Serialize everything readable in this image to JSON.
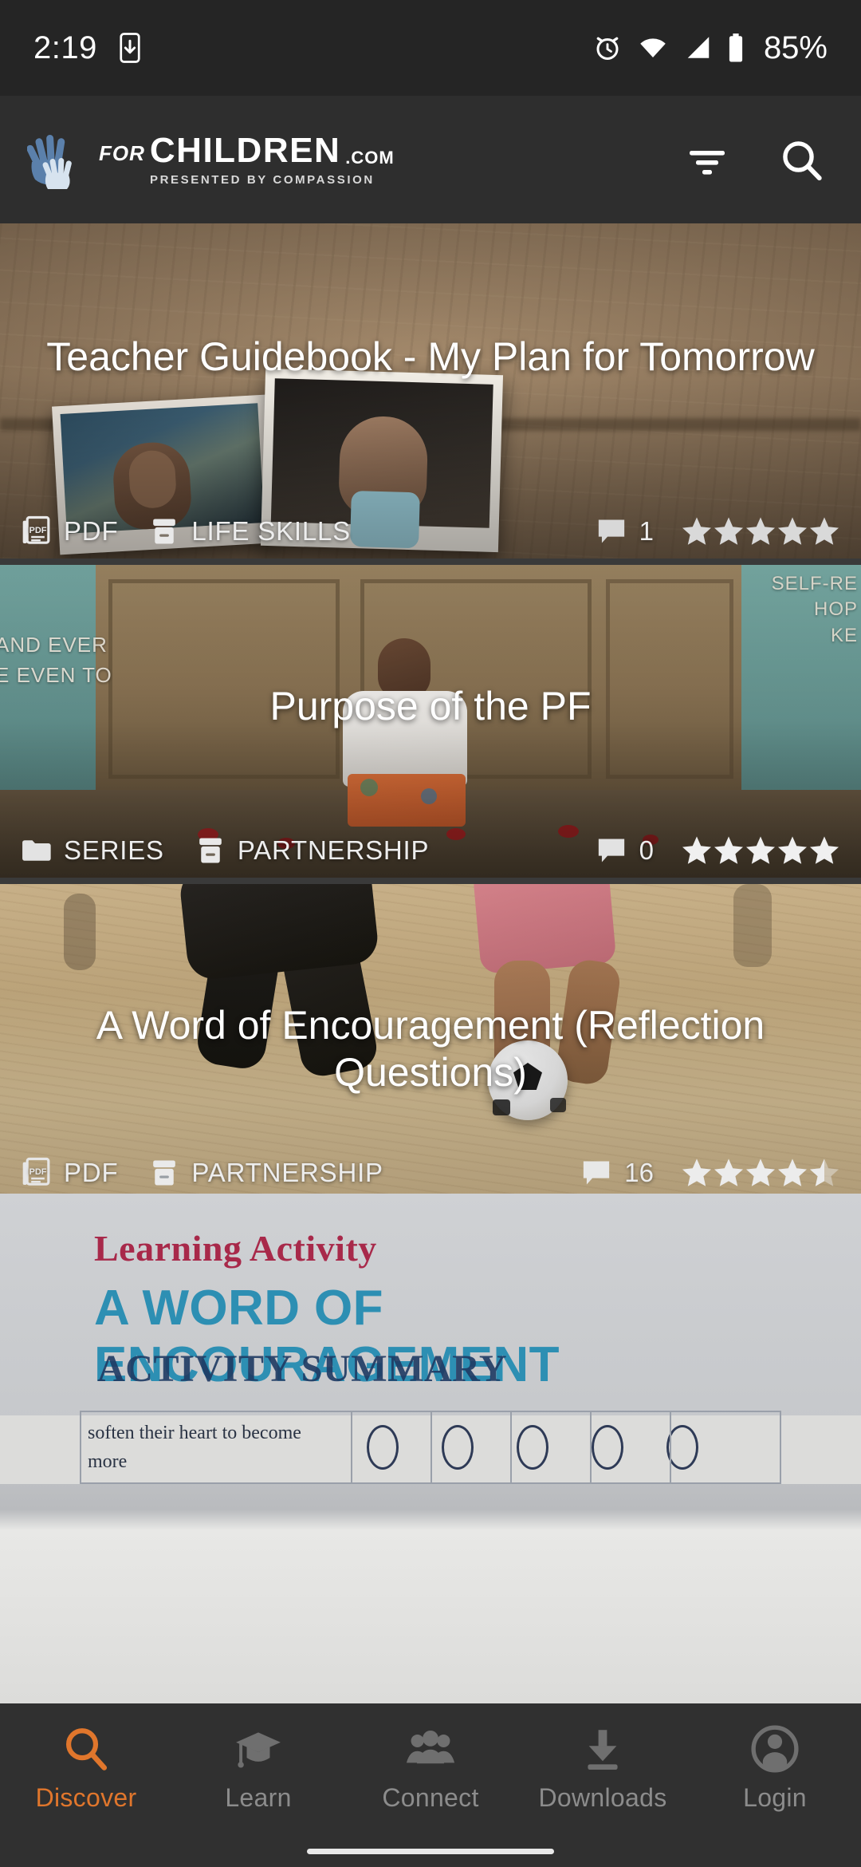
{
  "status_bar": {
    "time": "2:19",
    "battery_percent": "85%",
    "icons": [
      "download-to-phone-icon",
      "alarm-icon",
      "wifi-icon",
      "cellular-signal-icon",
      "battery-icon"
    ]
  },
  "app_bar": {
    "logo_for": "FOR",
    "logo_children": "CHILDREN",
    "logo_com": ".COM",
    "logo_subtitle": "PRESENTED BY COMPASSION",
    "filter_label": "filter-icon",
    "search_label": "search-icon"
  },
  "cards": [
    {
      "title": "Teacher Guidebook - My Plan for Tomorrow",
      "type_icon": "pdf-file-icon",
      "type_label": "PDF",
      "category_icon": "archive-box-icon",
      "category_label": "LIFE SKILLS",
      "comment_icon": "comment-icon",
      "comment_count": "1",
      "rating": 5,
      "rating_display": "5 of 5 stars"
    },
    {
      "title": "Purpose of the PF",
      "type_icon": "folder-icon",
      "type_label": "SERIES",
      "category_icon": "archive-box-icon",
      "category_label": "PARTNERSHIP",
      "comment_icon": "comment-icon",
      "comment_count": "0",
      "rating": 5,
      "rating_display": "5 of 5 stars"
    },
    {
      "title": "A Word of Encouragement (Reflection Questions)",
      "type_icon": "pdf-file-icon",
      "type_label": "PDF",
      "category_icon": "archive-box-icon",
      "category_label": "PARTNERSHIP",
      "comment_icon": "comment-icon",
      "comment_count": "16",
      "rating": 4.5,
      "rating_display": "4.5 of 5 stars",
      "preview_doc": {
        "kicker": "Learning Activity",
        "heading": "A WORD OF ENCOURAGEMENT",
        "section": "ACTIVITY SUMMARY",
        "row_text": "soften their heart to become more"
      }
    }
  ],
  "bottom_nav": {
    "items": [
      {
        "label": "Discover",
        "icon": "search-icon",
        "active": true
      },
      {
        "label": "Learn",
        "icon": "graduation-cap-icon",
        "active": false
      },
      {
        "label": "Connect",
        "icon": "people-group-icon",
        "active": false
      },
      {
        "label": "Downloads",
        "icon": "download-icon",
        "active": false
      },
      {
        "label": "Login",
        "icon": "person-account-icon",
        "active": false
      }
    ]
  },
  "colors": {
    "accent": "#E0762C",
    "status_bar_bg": "#252525",
    "app_bar_bg": "#2E2E2E",
    "bottom_nav_bg": "#303030",
    "inactive_nav": "#8C8C8C"
  }
}
